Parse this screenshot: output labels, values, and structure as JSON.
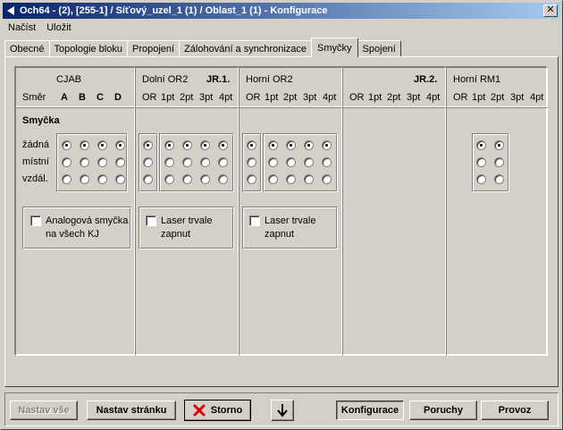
{
  "window": {
    "title": "Och64 - (2), [255-1] / Síťový_uzel_1 (1) / Oblast_1 (1) - Konfigurace",
    "close_label": "✕"
  },
  "menu": {
    "items": [
      "Načíst",
      "Uložit"
    ]
  },
  "tabs": [
    {
      "label": "Obecné",
      "active": false
    },
    {
      "label": "Topologie bloku",
      "active": false
    },
    {
      "label": "Propojení",
      "active": false
    },
    {
      "label": "Zálohování a synchronizace",
      "active": false
    },
    {
      "label": "Smyčky",
      "active": true
    },
    {
      "label": "Spojení",
      "active": false
    }
  ],
  "panel": {
    "cjab_label": "CJAB",
    "smer_label": "Směr",
    "cjab_cols": [
      "A",
      "B",
      "C",
      "D"
    ],
    "dolni_label": "Dolní OR2",
    "jr1_label": "JR.1.",
    "horni_label": "Horní OR2",
    "jr2_label": "JR.2.",
    "horni_rm1_label": "Horní RM1",
    "port_cols": [
      "OR",
      "1pt",
      "2pt",
      "3pt",
      "4pt"
    ],
    "smycka_label": "Smyčka",
    "row_labels": [
      "žádná",
      "místní",
      "vzdál."
    ],
    "checkbox_cjab_line1": "Analogová smyčka",
    "checkbox_cjab_line2": "na všech KJ",
    "checkbox_laser_line1": "Laser trvale",
    "checkbox_laser_line2": "zapnut"
  },
  "buttons": {
    "nastav_vse": "Nastav vše",
    "nastav_stranku": "Nastav stránku",
    "storno": "Storno",
    "konfigurace": "Konfigurace",
    "poruchy": "Poruchy",
    "provoz": "Provoz"
  },
  "icons": {
    "window_icon": "arrow-left-icon",
    "storno_icon": "red-x-icon",
    "down_icon": "arrow-down-icon"
  },
  "colors": {
    "title_start": "#0a246a",
    "title_end": "#a6caf0",
    "storno_x": "#d00000"
  }
}
